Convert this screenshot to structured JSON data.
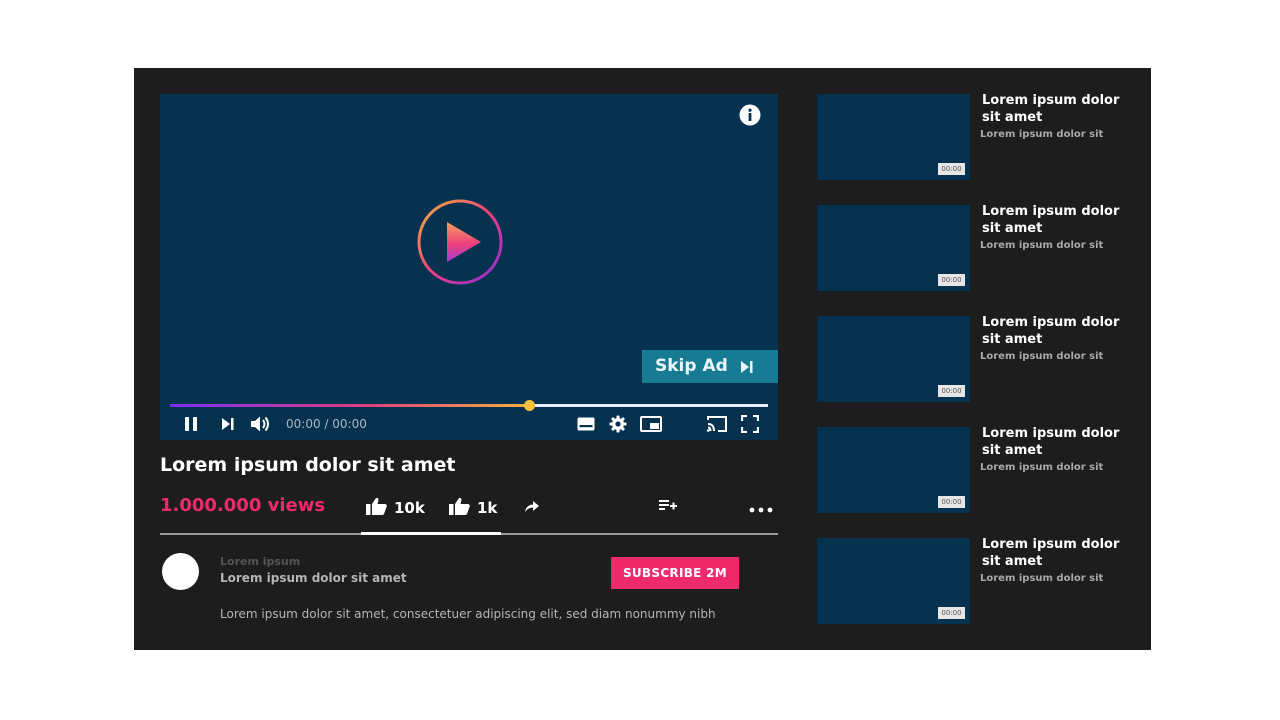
{
  "colors": {
    "app_bg": "#1d1d1d",
    "video_bg": "#06324f",
    "accent_pink": "#ee2a6b",
    "skip_bg": "#187b94",
    "knob": "#f5c23a"
  },
  "player": {
    "info_icon": "info-icon",
    "play_icon": "play-icon",
    "skip_ad_label": "Skip Ad",
    "skip_icon": "skip-next-icon",
    "progress_fraction": 0.6,
    "time_text": "00:00 / 00:00",
    "controls_left": [
      "pause-icon",
      "next-icon",
      "volume-icon"
    ],
    "controls_right": [
      "subtitles-icon",
      "settings-icon",
      "miniplayer-icon",
      "cast-icon",
      "fullscreen-icon"
    ]
  },
  "video": {
    "title": "Lorem ipsum dolor sit amet",
    "views": "1.000.000 views",
    "likes": "10k",
    "dislikes": "1k",
    "share_icon": "share-icon",
    "save_icon": "add-to-playlist-icon",
    "more_icon": "more-icon"
  },
  "channel": {
    "name": "Lorem ipsum",
    "subtitle": "Lorem ipsum dolor sit amet",
    "subscribe_label": "SUBSCRIBE  2M",
    "description": "Lorem ipsum dolor sit amet, consectetuer adipiscing elit, sed diam nonummy nibh"
  },
  "related": [
    {
      "title": "Lorem ipsum dolor sit amet",
      "subtitle": "Lorem ipsum dolor sit",
      "duration": "00:00"
    },
    {
      "title": "Lorem ipsum dolor sit amet",
      "subtitle": "Lorem ipsum dolor sit",
      "duration": "00:00"
    },
    {
      "title": "Lorem ipsum dolor sit amet",
      "subtitle": "Lorem ipsum dolor sit",
      "duration": "00:00"
    },
    {
      "title": "Lorem ipsum dolor sit amet",
      "subtitle": "Lorem ipsum dolor sit",
      "duration": "00:00"
    },
    {
      "title": "Lorem ipsum dolor sit amet",
      "subtitle": "Lorem ipsum dolor sit",
      "duration": "00:00"
    }
  ]
}
